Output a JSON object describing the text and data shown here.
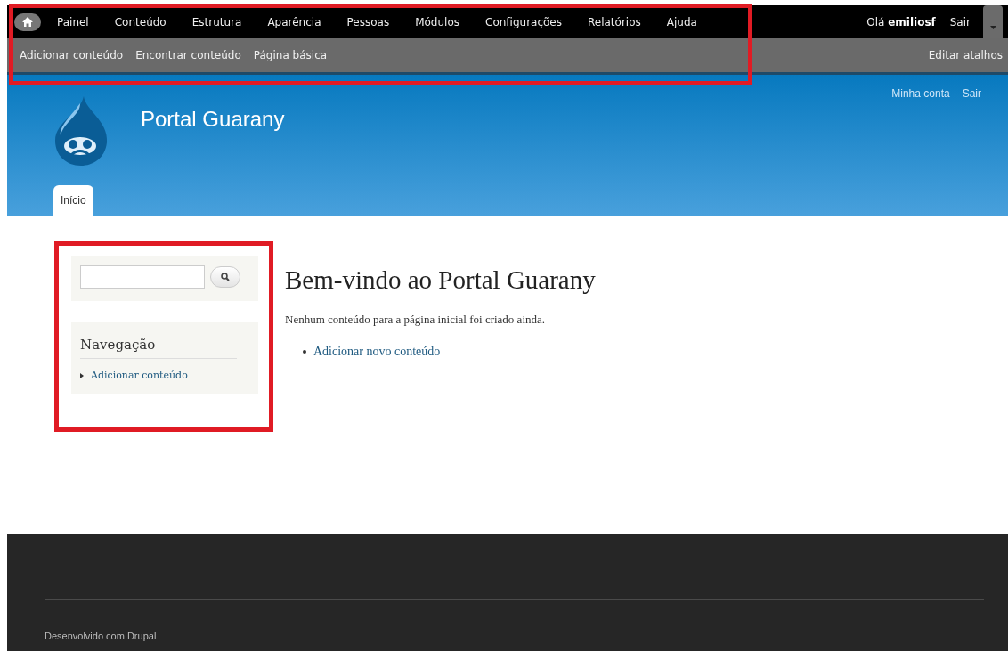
{
  "toolbar": {
    "menu": [
      {
        "label": "Painel"
      },
      {
        "label": "Conteúdo"
      },
      {
        "label": "Estrutura"
      },
      {
        "label": "Aparência"
      },
      {
        "label": "Pessoas"
      },
      {
        "label": "Módulos"
      },
      {
        "label": "Configurações"
      },
      {
        "label": "Relatórios"
      },
      {
        "label": "Ajuda"
      }
    ],
    "greeting": "Olá **emiliosf**",
    "logout": "Sair"
  },
  "shortcuts": {
    "items": [
      "Adicionar conteúdo",
      "Encontrar conteúdo",
      "Página básica"
    ],
    "edit": "Editar atalhos"
  },
  "header": {
    "site_name": "Portal Guarany",
    "secondary_menu": [
      "Minha conta",
      "Sair"
    ],
    "tabs": [
      {
        "label": "Início",
        "selected": true
      }
    ]
  },
  "sidebar": {
    "navigation": {
      "title": "Navegação",
      "items": [
        "Adicionar conteúdo"
      ]
    }
  },
  "main": {
    "title": "Bem-vindo ao Portal Guarany",
    "text": "Nenhum conteúdo para a página inicial foi criado ainda.",
    "links": [
      "Adicionar novo conteúdo"
    ]
  },
  "footer": {
    "text": "Desenvolvido com Drupal"
  }
}
